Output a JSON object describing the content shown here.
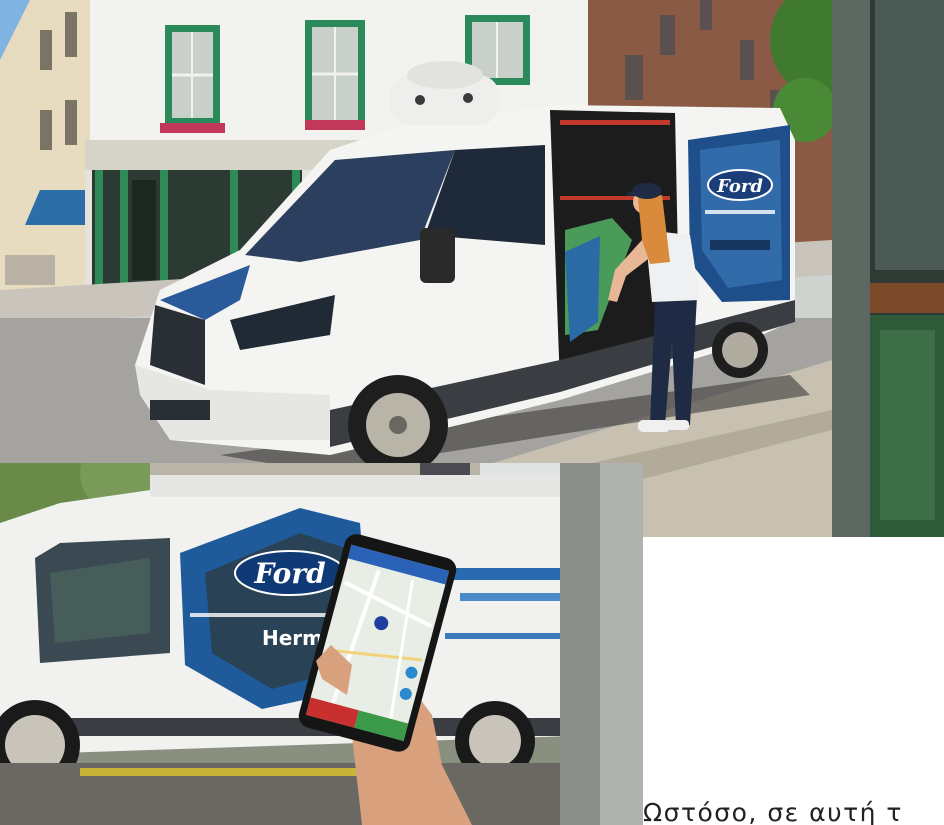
{
  "page": {
    "background": "#ffffff"
  },
  "photos": {
    "top": {
      "logo_text": "Ford"
    },
    "bottom": {
      "logo_text": "Ford",
      "brand_text": "Herme"
    }
  },
  "article": {
    "paragraph_text": "Ωστόσο, σε αυτή τ",
    "text_color": "#222222"
  },
  "colors": {
    "van_body": "#f4f4f2",
    "van_accent": "#1f5a9a",
    "window_frames": "#2a8a5a"
  }
}
